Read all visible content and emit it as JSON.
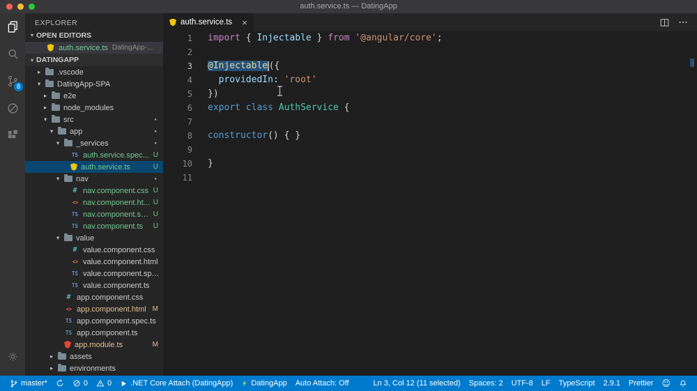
{
  "window": {
    "title": "auth.service.ts — DatingApp"
  },
  "colors": {
    "accent": "#007acc",
    "selection": "#264f78",
    "git_untracked": "#73c991",
    "git_modified": "#e2c08d",
    "activity_badge": "#007acc"
  },
  "activity_bar": {
    "scm_badge": "8"
  },
  "icons": {
    "activity_bar": [
      "explorer",
      "search",
      "source-control",
      "debug",
      "extensions",
      "settings-gear"
    ],
    "editor_actions": [
      "split-editor",
      "more-actions"
    ],
    "status_left": [
      "branch",
      "sync",
      "error",
      "warning",
      "play",
      "lightning"
    ],
    "status_right": [
      "smiley",
      "bell"
    ]
  },
  "sidebar": {
    "title": "EXPLORER",
    "open_editors_label": "OPEN EDITORS",
    "root_label": "DATINGAPP",
    "open_editors": [
      {
        "label": "auth.service.ts",
        "detail": "DatingApp-...",
        "icon": "service"
      }
    ],
    "tree": [
      {
        "label": ".vscode",
        "type": "folder",
        "level": 0,
        "expanded": false
      },
      {
        "label": "DatingApp-SPA",
        "type": "folder",
        "level": 0,
        "expanded": true
      },
      {
        "label": "e2e",
        "type": "folder",
        "level": 1,
        "expanded": false
      },
      {
        "label": "node_modules",
        "type": "folder",
        "level": 1,
        "expanded": false
      },
      {
        "label": "src",
        "type": "folder",
        "level": 1,
        "expanded": true,
        "dot": true
      },
      {
        "label": "app",
        "type": "folder",
        "level": 2,
        "expanded": true,
        "dot": true
      },
      {
        "label": "_services",
        "type": "folder",
        "level": 3,
        "expanded": true,
        "dot": true
      },
      {
        "label": "auth.service.spec...",
        "type": "file",
        "level": 4,
        "icon": "spec",
        "badge": "U",
        "git": "u"
      },
      {
        "label": "auth.service.ts",
        "type": "file",
        "level": 4,
        "icon": "service",
        "badge": "U",
        "git": "u",
        "selected": true
      },
      {
        "label": "nav",
        "type": "folder",
        "level": 3,
        "expanded": true,
        "dot": true
      },
      {
        "label": "nav.component.css",
        "type": "file",
        "level": 4,
        "icon": "css",
        "badge": "U",
        "git": "u"
      },
      {
        "label": "nav.component.ht...",
        "type": "file",
        "level": 4,
        "icon": "html",
        "badge": "U",
        "git": "u"
      },
      {
        "label": "nav.component.sp...",
        "type": "file",
        "level": 4,
        "icon": "spec",
        "badge": "U",
        "git": "u"
      },
      {
        "label": "nav.component.ts",
        "type": "file",
        "level": 4,
        "icon": "ts",
        "badge": "U",
        "git": "u"
      },
      {
        "label": "value",
        "type": "folder",
        "level": 3,
        "expanded": true
      },
      {
        "label": "value.component.css",
        "type": "file",
        "level": 4,
        "icon": "css"
      },
      {
        "label": "value.component.html",
        "type": "file",
        "level": 4,
        "icon": "html"
      },
      {
        "label": "value.component.spec...",
        "type": "file",
        "level": 4,
        "icon": "spec"
      },
      {
        "label": "value.component.ts",
        "type": "file",
        "level": 4,
        "icon": "ts"
      },
      {
        "label": "app.component.css",
        "type": "file",
        "level": 3,
        "icon": "css"
      },
      {
        "label": "app.component.html",
        "type": "file",
        "level": 3,
        "icon": "html",
        "badge": "M",
        "git": "m"
      },
      {
        "label": "app.component.spec.ts",
        "type": "file",
        "level": 3,
        "icon": "spec"
      },
      {
        "label": "app.component.ts",
        "type": "file",
        "level": 3,
        "icon": "ts"
      },
      {
        "label": "app.module.ts",
        "type": "file",
        "level": 3,
        "icon": "module",
        "badge": "M",
        "git": "m"
      },
      {
        "label": "assets",
        "type": "folder",
        "level": 2,
        "expanded": false
      },
      {
        "label": "environments",
        "type": "folder",
        "level": 2,
        "expanded": false
      }
    ]
  },
  "editor": {
    "tab": {
      "label": "auth.service.ts",
      "icon": "service",
      "close_glyph": "×"
    },
    "lines": [
      {
        "tokens": [
          [
            "k1",
            "import"
          ],
          [
            "p",
            " { "
          ],
          [
            "v",
            "Injectable"
          ],
          [
            "p",
            " } "
          ],
          [
            "k1",
            "from"
          ],
          [
            "p",
            " "
          ],
          [
            "s",
            "'@angular/core'"
          ],
          [
            "p",
            ";"
          ]
        ]
      },
      {
        "tokens": []
      },
      {
        "active": true,
        "tokens": [
          [
            "d",
            "@Injectable",
            "sel"
          ],
          [
            "p",
            "({"
          ]
        ]
      },
      {
        "tokens": [
          [
            "p",
            "  "
          ],
          [
            "v",
            "providedIn"
          ],
          [
            "p",
            ": "
          ],
          [
            "s",
            "'root'"
          ]
        ]
      },
      {
        "tokens": [
          [
            "p",
            "})"
          ]
        ]
      },
      {
        "tokens": [
          [
            "k2",
            "export"
          ],
          [
            "p",
            " "
          ],
          [
            "k2",
            "class"
          ],
          [
            "p",
            " "
          ],
          [
            "t",
            "AuthService"
          ],
          [
            "p",
            " {"
          ]
        ]
      },
      {
        "tokens": []
      },
      {
        "tokens": [
          [
            "k2",
            "constructor"
          ],
          [
            "p",
            "() { }"
          ]
        ]
      },
      {
        "tokens": []
      },
      {
        "tokens": [
          [
            "p",
            "}"
          ]
        ]
      },
      {
        "tokens": []
      }
    ]
  },
  "status_bar": {
    "left": [
      {
        "name": "git-branch",
        "icon": "branch",
        "label": "master*"
      },
      {
        "name": "sync",
        "icon": "sync",
        "label": ""
      },
      {
        "name": "errors",
        "icon": "error",
        "label": "0"
      },
      {
        "name": "warnings",
        "icon": "warning",
        "label": "0"
      },
      {
        "name": "debug-launch",
        "icon": "play",
        "label": ".NET Core Attach (DatingApp)"
      },
      {
        "name": "app-task",
        "icon": "lightning",
        "label": "DatingApp"
      },
      {
        "name": "auto-attach",
        "label": "Auto Attach: Off"
      }
    ],
    "right": [
      {
        "name": "cursor-position",
        "label": "Ln 3, Col 12 (11 selected)"
      },
      {
        "name": "indentation",
        "label": "Spaces: 2"
      },
      {
        "name": "encoding",
        "label": "UTF-8"
      },
      {
        "name": "eol",
        "label": "LF"
      },
      {
        "name": "language-mode",
        "label": "TypeScript"
      },
      {
        "name": "ts-version",
        "label": "2.9.1"
      },
      {
        "name": "formatter",
        "label": "Prettier"
      },
      {
        "name": "feedback",
        "icon": "smiley",
        "label": ""
      },
      {
        "name": "notifications",
        "icon": "bell",
        "label": ""
      }
    ]
  }
}
